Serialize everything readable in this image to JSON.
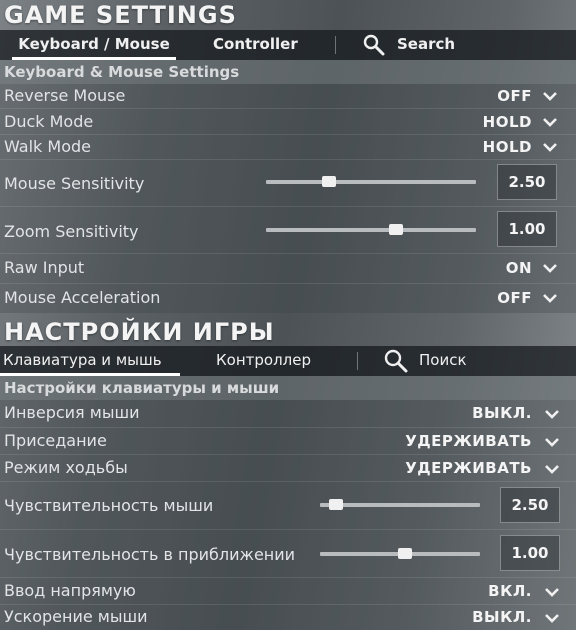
{
  "en": {
    "title": "GAME SETTINGS",
    "tabs": [
      "Keyboard / Mouse",
      "Controller",
      "Search"
    ],
    "section": "Keyboard & Mouse Settings",
    "rows": [
      {
        "label": "Reverse Mouse",
        "value": "OFF"
      },
      {
        "label": "Duck Mode",
        "value": "HOLD"
      },
      {
        "label": "Walk Mode",
        "value": "HOLD"
      },
      {
        "label": "Mouse Sensitivity",
        "value": "2.50",
        "level": 0.3
      },
      {
        "label": "Zoom Sensitivity",
        "value": "1.00",
        "level": 0.62
      },
      {
        "label": "Raw Input",
        "value": "ON"
      },
      {
        "label": "Mouse Acceleration",
        "value": "OFF"
      }
    ]
  },
  "ru": {
    "title": "НАСТРОЙКИ ИГРЫ",
    "tabs": [
      "Клавиатура и мышь",
      "Контроллер",
      "Поиск"
    ],
    "section": "Настройки клавиатуры и мыши",
    "rows": [
      {
        "label": "Инверсия мыши",
        "value": "ВЫКЛ."
      },
      {
        "label": "Приседание",
        "value": "УДЕРЖИВАТЬ"
      },
      {
        "label": "Режим ходьбы",
        "value": "УДЕРЖИВАТЬ"
      },
      {
        "label": "Чувствительность мыши",
        "value": "2.50",
        "level": 0.1
      },
      {
        "label": "Чувствительность в приближении",
        "value": "1.00",
        "level": 0.53
      },
      {
        "label": "Ввод напрямую",
        "value": "ВКЛ."
      },
      {
        "label": "Ускорение мыши",
        "value": "ВЫКЛ."
      }
    ]
  },
  "icons": {
    "search": "search-icon",
    "dropdown": "chevron-down-icon"
  }
}
